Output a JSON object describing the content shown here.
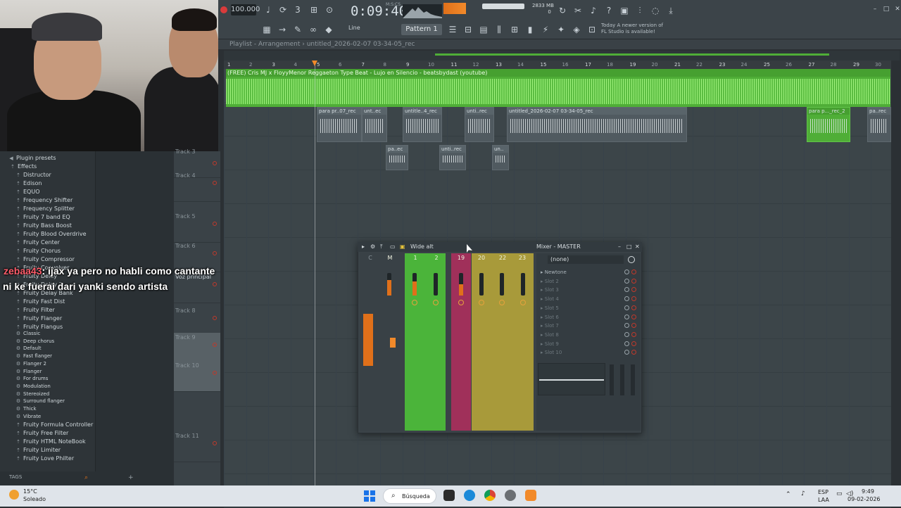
{
  "toolbar": {
    "tempo": "100.000",
    "time": "0:09:40",
    "time_sub": "M:S:CS",
    "volume_value": "50",
    "memory": "2833 MB",
    "memory_sub": "0",
    "pattern": "Pattern 1",
    "tool_label": "Line",
    "news_line1": "Today  A newer version of",
    "news_line2": "FL Studio is available!"
  },
  "playlist": {
    "title": "Playlist - Arrangement",
    "filename": "untitled_2026-02-07 03-34-05_rec",
    "ruler": [
      "1",
      "3",
      "5",
      "7",
      "9",
      "11",
      "13",
      "15",
      "17",
      "19",
      "21",
      "23",
      "25",
      "27",
      "29"
    ],
    "ruler_mid": [
      "2",
      "4",
      "6",
      "8",
      "10",
      "12",
      "14",
      "16",
      "18",
      "20",
      "22",
      "24",
      "26",
      "28",
      "30"
    ],
    "beat_clip": "(FREE) Cris MJ x FloyyMenor Reggaeton Type Beat - Lujo en Silencio - beatsbydast (youtube)",
    "clips_row1": [
      "para pr..07_rec",
      "unt..ec",
      "untitle..4_rec",
      "unti..rec",
      "untitled_2026-02-07 03-34-05_rec",
      "para p..._rec_2",
      "pa..rec"
    ],
    "clips_row2": [
      "pa..ec",
      "unti..rec",
      "un.."
    ],
    "tracks": [
      "Track 3",
      "Track 4",
      "Track 5",
      "Track 6",
      "Voz principal",
      "Track 8",
      "Track 9",
      "Track 10",
      "Track 11"
    ]
  },
  "browser": {
    "header": "Plugin presets",
    "group": "Effects",
    "items": [
      "Distructor",
      "Edison",
      "EQUO",
      "Frequency Shifter",
      "Frequency Splitter",
      "Fruity 7 band EQ",
      "Fruity Bass Boost",
      "Fruity Blood Overdrive",
      "Fruity Center",
      "Fruity Chorus",
      "Fruity Compressor",
      "Fruity Convolver",
      "Fruity Delay",
      "Fruity Delay 3",
      "Fruity Delay Bank",
      "Fruity Fast Dist",
      "Fruity Filter",
      "Fruity Flanger",
      "Fruity Flangus"
    ],
    "flangus_presets": [
      "Classic",
      "Deep chorus",
      "Default",
      "Fast flanger",
      "Flanger 2",
      "Flanger",
      "For drums",
      "Modulation",
      "Stereoized",
      "Surround flanger",
      "Thick",
      "Vibrate"
    ],
    "items_after": [
      "Fruity Formula Controller",
      "Fruity Free Filter",
      "Fruity HTML NoteBook",
      "Fruity Limiter",
      "Fruity Love Philter"
    ],
    "tags_label": "TAGS"
  },
  "chat": {
    "line1_user": "zebaa43",
    "line1_text": ": ijax ya pero no habli como cantante",
    "line2_text": "ni ke fuerai dari yanki sendo artista"
  },
  "mixer": {
    "preset": "Wide alt",
    "title": "Mixer - MASTER",
    "master_label": "M",
    "strip_c_label": "C",
    "strip_numbers": [
      "1",
      "2",
      "19",
      "20",
      "22",
      "23"
    ],
    "fx_select": "(none)",
    "slots": [
      "Newtone",
      "Slot 2",
      "Slot 3",
      "Slot 4",
      "Slot 5",
      "Slot 6",
      "Slot 7",
      "Slot 8",
      "Slot 9",
      "Slot 10"
    ]
  },
  "taskbar": {
    "weather_temp": "15°C",
    "weather_desc": "Soleado",
    "search": "Búsqueda",
    "lang1": "ESP",
    "lang2": "LAA",
    "time": "9:49",
    "date": "09-02-2026"
  },
  "colors": {
    "beat_clip": "#4fae37",
    "accent_orange": "#e0701a",
    "record_red": "#d93b3b",
    "mixer_green": "#4bb43a",
    "mixer_pink": "#a0305a",
    "mixer_olive": "#a89a3a"
  }
}
